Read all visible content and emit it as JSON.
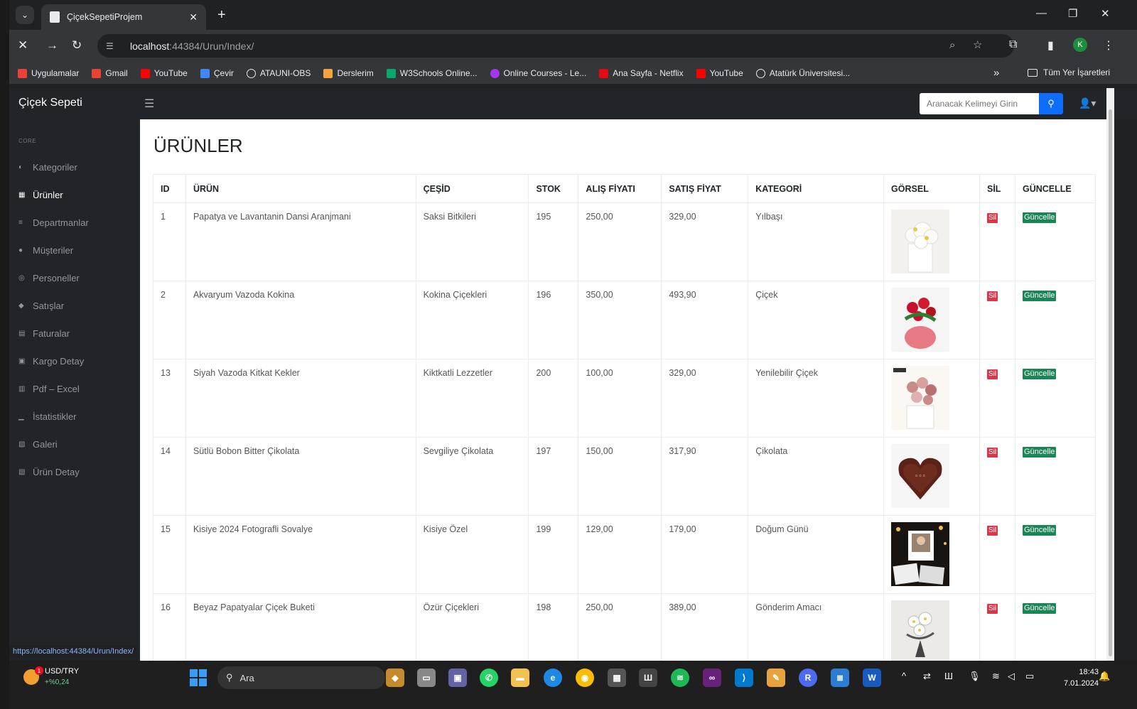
{
  "browser": {
    "tab_title": "ÇiçekSepetiProjem",
    "url_host": "localhost",
    "url_path": ":44384/Urun/Index/",
    "bookmarks": [
      "Uygulamalar",
      "Gmail",
      "YouTube",
      "Çevir",
      "ATAUNI-OBS",
      "Derslerim",
      "W3Schools Online...",
      "Online Courses - Le...",
      "Ana Sayfa - Netflix",
      "YouTube",
      "Atatürk Üniversitesi..."
    ],
    "bookmarks_more": "»",
    "all_bookmarks": "Tüm Yer İşaretleri",
    "profile_initial": "K",
    "status_url": "https://localhost:44384/Urun/Index/"
  },
  "app": {
    "brand": "Çiçek Sepeti",
    "search_placeholder": "Aranacak Kelimeyi Girin",
    "sidebar_heading": "CORE",
    "sidebar_items": [
      "Kategoriler",
      "Ürünler",
      "Departmanlar",
      "Müşteriler",
      "Personeller",
      "Satışlar",
      "Faturalar",
      "Kargo Detay",
      "Pdf – Excel",
      "İstatistikler",
      "Galeri",
      "Ürün Detay"
    ],
    "page_title": "ÜRÜNLER",
    "columns": [
      "ID",
      "ÜRÜN",
      "ÇEŞİD",
      "STOK",
      "ALIŞ FİYATI",
      "SATIŞ FİYAT",
      "KATEGORİ",
      "GÖRSEL",
      "SİL",
      "GÜNCELLE"
    ],
    "delete_label": "Sil",
    "update_label": "Güncelle",
    "rows": [
      {
        "id": "1",
        "urun": "Papatya ve Lavantanin Dansi Aranjmani",
        "cesid": "Saksi Bitkileri",
        "stok": "195",
        "alis": "250,00",
        "satis": "329,00",
        "kategori": "Yılbaşı",
        "img": "white-flowers"
      },
      {
        "id": "2",
        "urun": "Akvaryum Vazoda Kokina",
        "cesid": "Kokina Çiçekleri",
        "stok": "196",
        "alis": "350,00",
        "satis": "493,90",
        "kategori": "Çiçek",
        "img": "red-kokina"
      },
      {
        "id": "13",
        "urun": "Siyah Vazoda Kitkat Kekler",
        "cesid": "Kiktkatli Lezzetler",
        "stok": "200",
        "alis": "100,00",
        "satis": "329,00",
        "kategori": "Yenilebilir Çiçek",
        "img": "cake-bouquet"
      },
      {
        "id": "14",
        "urun": "Sütlü Bobon Bitter Çikolata",
        "cesid": "Sevgiliye Çikolata",
        "stok": "197",
        "alis": "150,00",
        "satis": "317,90",
        "kategori": "Çikolata",
        "img": "heart-chocolate"
      },
      {
        "id": "15",
        "urun": "Kisiye 2024 Fotografli Sovalye",
        "cesid": "Kisiye Özel",
        "stok": "199",
        "alis": "129,00",
        "satis": "179,00",
        "kategori": "Doğum Günü",
        "img": "photo-easel"
      },
      {
        "id": "16",
        "urun": "Beyaz Papatyalar Çiçek Buketi",
        "cesid": "Özür Çiçekleri",
        "stok": "198",
        "alis": "250,00",
        "satis": "389,00",
        "kategori": "Gönderim Amacı",
        "img": "daisy-bouquet"
      }
    ]
  },
  "taskbar": {
    "currency": "USD/TRY",
    "currency_change": "+%0,24",
    "weather_badge": "1",
    "search_label": "Ara",
    "time": "18:43",
    "date": "7.01.2024"
  },
  "colors": {
    "sidebar_bg": "#212529",
    "accent": "#0d6efd",
    "delete": "#dc3545",
    "update": "#198754"
  }
}
